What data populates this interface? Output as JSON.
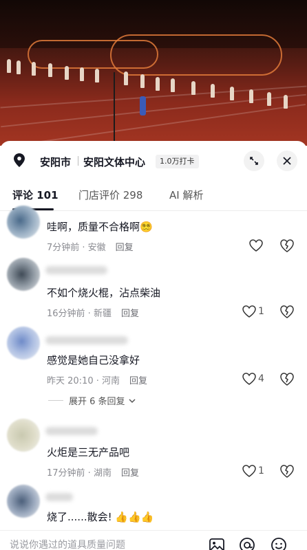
{
  "header": {
    "city": "安阳市",
    "venue": "安阳文体中心",
    "badge": "1.0万打卡"
  },
  "tabs": [
    {
      "label": "评论 101",
      "active": true
    },
    {
      "label": "门店评价 298",
      "active": false
    },
    {
      "label": "AI 解析",
      "active": false
    }
  ],
  "comments": [
    {
      "text": "哇啊，质量不合格啊",
      "emoji": "😵‍💫",
      "meta": "7分钟前 · 安徽",
      "reply": "回复",
      "likes": ""
    },
    {
      "text": "不如个烧火棍，沾点柴油",
      "emoji": "",
      "meta": "16分钟前 · 新疆",
      "reply": "回复",
      "likes": "1"
    },
    {
      "text": "感觉是她自己没拿好",
      "emoji": "",
      "meta": "昨天 20:10 · 河南",
      "reply": "回复",
      "likes": "4"
    },
    {
      "text": "火炬是三无产品吧",
      "emoji": "",
      "meta": "17分钟前 · 湖南",
      "reply": "回复",
      "likes": "1"
    },
    {
      "text": "烧了......散会!",
      "emoji": "👍👍👍",
      "meta": "",
      "reply": "",
      "likes": ""
    }
  ],
  "expand_replies": "展开 6 条回复",
  "input": {
    "placeholder": "说说你遇过的道具质量问题"
  },
  "icons": {
    "location": "location-pin-icon",
    "minimize": "minimize-icon",
    "close": "close-icon",
    "like": "heart-icon",
    "dislike": "broken-heart-icon",
    "image": "image-icon",
    "mention": "at-icon",
    "emoji": "emoji-icon"
  }
}
